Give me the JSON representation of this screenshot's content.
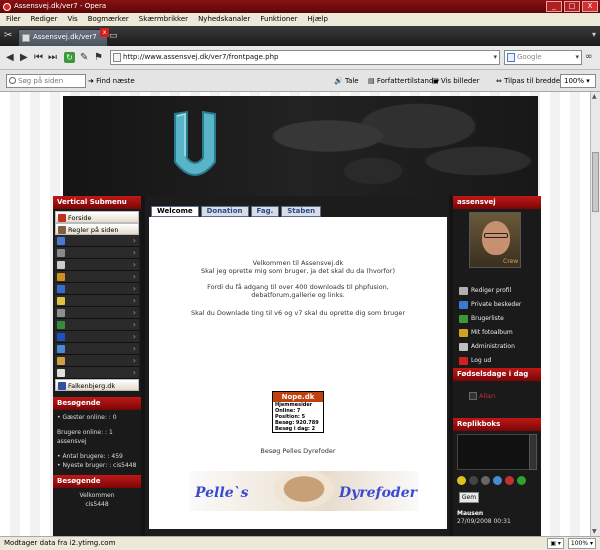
{
  "window": {
    "title": "Assensvej.dk/ver7 - Opera",
    "buttons": [
      "_",
      "□",
      "X"
    ]
  },
  "menu": [
    "Filer",
    "Rediger",
    "Vis",
    "Bogmærker",
    "Skærmbrikker",
    "Nyhedskanaler",
    "Funktioner",
    "Hjælp"
  ],
  "tab": {
    "label": "Assensvej.dk/ver7",
    "close": "x"
  },
  "address": {
    "url": "http://www.assensvej.dk/ver7/frontpage.php",
    "search_placeholder": "Google"
  },
  "toolbar": {
    "find_placeholder": "Søg på siden",
    "find_next": "Find næste",
    "tale": "Tale",
    "forfatter": "Forfattertilstand",
    "vis_billeder": "Vis billeder",
    "tilpas": "Tilpas til bredden",
    "zoom": "100%"
  },
  "left": {
    "submenu_title": "Vertical Submenu",
    "items": [
      {
        "label": "Forside",
        "light": true,
        "color": "#c03020"
      },
      {
        "label": "Regler på siden",
        "light": true,
        "color": "#806040"
      },
      {
        "label": "",
        "light": false,
        "color": "#4a7ad0"
      },
      {
        "label": "",
        "light": false,
        "color": "#888888"
      },
      {
        "label": "",
        "light": false,
        "color": "#cccccc"
      },
      {
        "label": "",
        "light": false,
        "color": "#d09020"
      },
      {
        "label": "",
        "light": false,
        "color": "#3a6ad0"
      },
      {
        "label": "",
        "light": false,
        "color": "#e0c040"
      },
      {
        "label": "",
        "light": false,
        "color": "#909090"
      },
      {
        "label": "",
        "light": false,
        "color": "#3a8a3a"
      },
      {
        "label": "",
        "light": false,
        "color": "#2050c0"
      },
      {
        "label": "",
        "light": false,
        "color": "#4a8ad0"
      },
      {
        "label": "",
        "light": false,
        "color": "#d0a040"
      },
      {
        "label": "",
        "light": false,
        "color": "#e0e0e0"
      },
      {
        "label": "Falkenbjerg.dk",
        "light": true,
        "color": "#3050a0"
      }
    ],
    "besogende_title": "Besøgende",
    "besogende_lines": [
      "• Gæster online: : 0",
      "",
      "Brugere online: : 1",
      "assensvej",
      "",
      "• Antal brugere: : 459",
      "• Nyeste bruger: : cis5448"
    ],
    "besogende2_title": "Besøgende",
    "welcome_lines": [
      "Velkommen",
      "cis5448"
    ]
  },
  "center": {
    "tabs": [
      "Welcome",
      "Donation",
      "Fag.",
      "Staben"
    ],
    "welcome_lines": [
      "Velkommen til Assensvej.dk",
      "Skal jeg oprette mig som bruger, ja det skal du da (hvorfor)"
    ],
    "info_lines": [
      "Fordi du få adgang til over 400 downloads til phpfusion,",
      "debatforum,gallerie og links."
    ],
    "download_line": "Skal du Downlade ting til v6 og v7 skal du oprette dig som bruger",
    "nope": {
      "title": "Nope.dk",
      "lines": [
        "Hjemmesider",
        "Online:   7",
        "Position:   5",
        "Besøg:   920.789",
        "Besøg i dag:   2"
      ]
    },
    "besog_line": "Besøg Pelles Dyrefoder",
    "dog_left": "Pelle`s",
    "dog_right": "Dyrefoder"
  },
  "right": {
    "user_title": "assensvej",
    "crew": "Crew",
    "links": [
      {
        "label": "Rediger profil",
        "color": "#b0b0b0"
      },
      {
        "label": "Private beskeder",
        "color": "#3a7ad0"
      },
      {
        "label": "Brugerliste",
        "color": "#3a9a3a"
      },
      {
        "label": "Mit fotoalbum",
        "color": "#d0a020"
      },
      {
        "label": "Administration",
        "color": "#c0c0c0"
      },
      {
        "label": "Log ud",
        "color": "#d02020"
      }
    ],
    "bday_title": "Fødselsdage i dag",
    "bday_name": "Allan",
    "shout_title": "Replikboks",
    "smiley_colors": [
      "#e0c020",
      "#444444",
      "#666666",
      "#4a8ad0",
      "#c03030",
      "#30a030"
    ],
    "gem": "Gem",
    "shout_author": "Mausen",
    "shout_time": "27/09/2008 00:31"
  },
  "status": {
    "text": "Modtager data fra i2.ytimg.com",
    "zoom": "100%"
  }
}
